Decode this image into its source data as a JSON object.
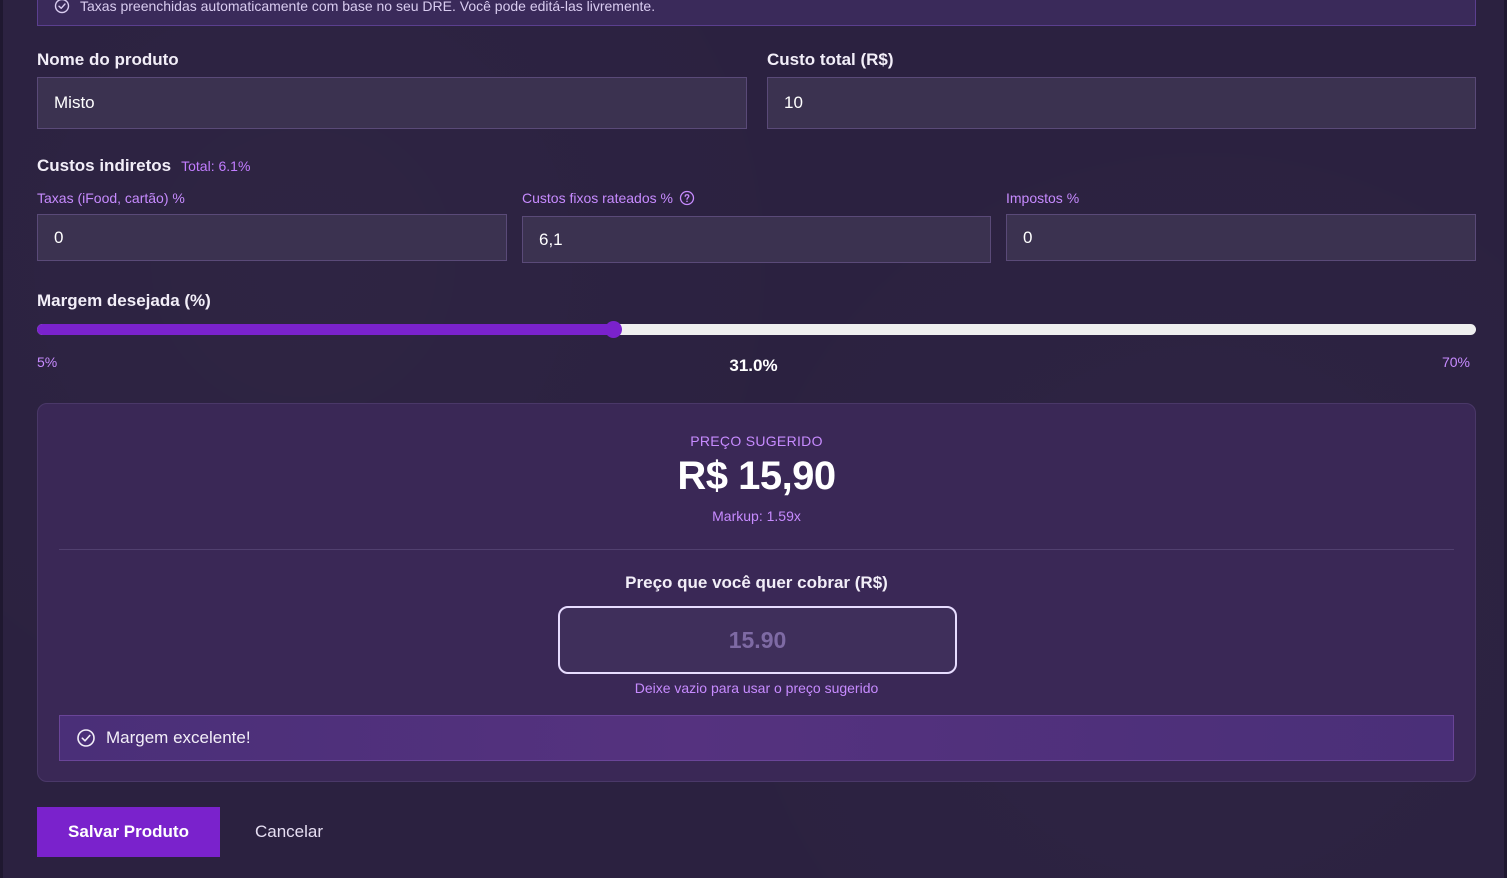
{
  "banner": {
    "text": "Taxas preenchidas automaticamente com base no seu DRE. Você pode editá-las livremente.",
    "icon": "check-circle-icon"
  },
  "product": {
    "name_label": "Nome do produto",
    "name_value": "Misto",
    "cost_label": "Custo total (R$)",
    "cost_value": "10"
  },
  "indirect": {
    "title": "Custos indiretos",
    "total": "Total: 6.1%",
    "fees_label": "Taxas (iFood, cartão) %",
    "fees_value": "0",
    "fixed_label": "Custos fixos rateados %",
    "fixed_value": "6,1",
    "fixed_help_icon": "question-circle-icon",
    "taxes_label": "Impostos %",
    "taxes_value": "0"
  },
  "margin": {
    "label": "Margem desejada (%)",
    "min_label": "5%",
    "max_label": "70%",
    "value_label": "31.0%",
    "min": 5,
    "max": 70,
    "value": 31.0
  },
  "result": {
    "suggested_label": "PREÇO SUGERIDO",
    "suggested_price": "R$ 15,90",
    "markup": "Markup: 1.59x",
    "charge_label": "Preço que você quer cobrar (R$)",
    "charge_placeholder": "15.90",
    "charge_help": "Deixe vazio para usar o preço sugerido",
    "status_text": "Margem excelente!",
    "status_icon": "check-circle-icon"
  },
  "actions": {
    "save_label": "Salvar Produto",
    "cancel_label": "Cancelar"
  },
  "colors": {
    "accent": "#7a22cc",
    "label_purple": "#c78bff",
    "background": "#2b2140",
    "card": "#3a2856"
  }
}
